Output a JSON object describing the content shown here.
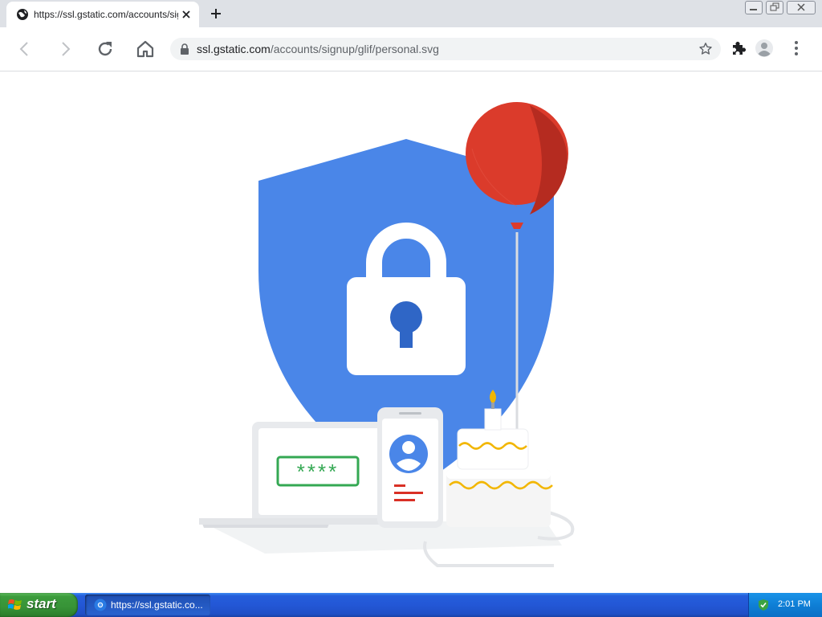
{
  "browser": {
    "tab": {
      "title": "https://ssl.gstatic.com/accounts/signup/glif/personal.svg"
    },
    "address_bar": {
      "host": "ssl.gstatic.com",
      "path": "/accounts/signup/glif/personal.svg"
    }
  },
  "illustration": {
    "password_field": "****",
    "colors": {
      "shield": "#4a86e8",
      "balloon": "#db3b2b",
      "password_border": "#34a853",
      "keyhole": "#2f66c6",
      "cake_ribbon": "#f2b600"
    }
  },
  "taskbar": {
    "start_label": "start",
    "task_item_label": "https://ssl.gstatic.co...",
    "clock": "2:01 PM"
  }
}
